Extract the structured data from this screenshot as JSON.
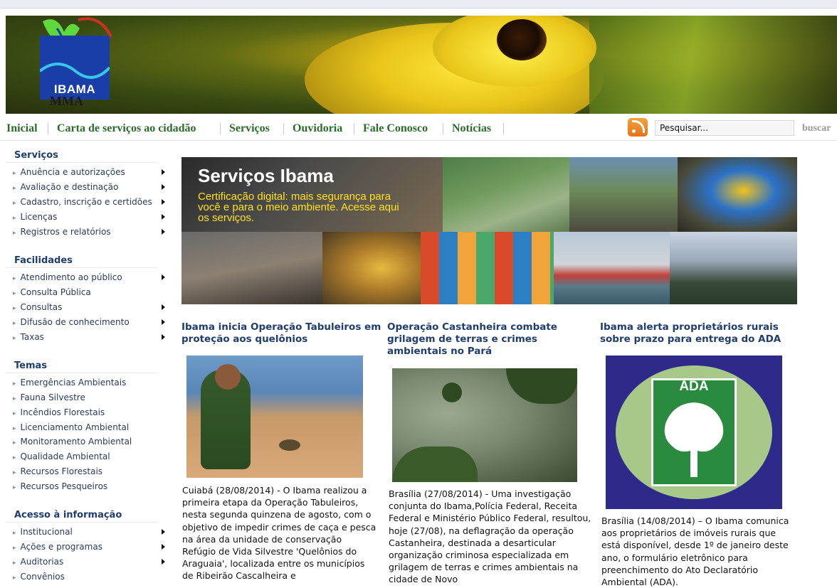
{
  "header": {
    "logo_text": "IBAMA",
    "logo_sub": "MMA"
  },
  "nav": {
    "items": [
      "Inicial",
      "Carta de serviços ao cidadão",
      "Serviços",
      "Ouvidoria",
      "Fale Conosco",
      "Notícias"
    ],
    "search_placeholder": "Pesquisar...",
    "search_button": "buscar"
  },
  "sidebar": {
    "sections": [
      {
        "title": "Serviços",
        "items": [
          {
            "label": "Anuência e autorizações",
            "submenu": true
          },
          {
            "label": "Avaliação e destinação",
            "submenu": true
          },
          {
            "label": "Cadastro, inscrição e certidões",
            "submenu": true
          },
          {
            "label": "Licenças",
            "submenu": true
          },
          {
            "label": "Registros e relatórios",
            "submenu": true
          }
        ]
      },
      {
        "title": "Facilidades",
        "items": [
          {
            "label": "Atendimento ao público",
            "submenu": true
          },
          {
            "label": "Consulta Pública",
            "submenu": false
          },
          {
            "label": "Consultas",
            "submenu": true
          },
          {
            "label": "Difusão de conhecimento",
            "submenu": true
          },
          {
            "label": "Taxas",
            "submenu": true
          }
        ]
      },
      {
        "title": "Temas",
        "items": [
          {
            "label": "Emergências Ambientais",
            "submenu": false
          },
          {
            "label": "Fauna Silvestre",
            "submenu": false
          },
          {
            "label": "Incêndios Florestais",
            "submenu": false
          },
          {
            "label": "Licenciamento Ambiental",
            "submenu": false
          },
          {
            "label": "Monitoramento Ambiental",
            "submenu": false
          },
          {
            "label": "Qualidade Ambiental",
            "submenu": false
          },
          {
            "label": "Recursos Florestais",
            "submenu": false
          },
          {
            "label": "Recursos Pesqueiros",
            "submenu": false
          }
        ]
      },
      {
        "title": "Acesso à informação",
        "items": [
          {
            "label": "Institucional",
            "submenu": true
          },
          {
            "label": "Ações e programas",
            "submenu": true
          },
          {
            "label": "Auditorias",
            "submenu": true
          },
          {
            "label": "Convênios",
            "submenu": false
          }
        ]
      }
    ]
  },
  "hero": {
    "title": "Serviços Ibama",
    "subtitle": "Certificação digital: mais segurança para você e para o meio ambiente. Acesse aqui os serviços."
  },
  "news": [
    {
      "title": "Ibama inicia Operação Tabuleiros em proteção aos quelônios",
      "text": "Cuiabá (28/08/2014) - O Ibama realizou a primeira etapa da Operação Tabuleiros, nesta segunda quinzena de agosto, com o objetivo de impedir crimes de caça e pesca na área da unidade de conservação Refúgio de Vida Silvestre 'Quelônios do Araguaia', localizada entre os municípios de Ribeirão Cascalheira e"
    },
    {
      "title": "Operação Castanheira combate grilagem de terras e crimes ambientais no Pará",
      "text": "Brasília (27/08/2014) - Uma investigação conjunta do Ibama,Polícia Federal, Receita Federal e Ministério Público Federal, resultou, hoje (27/08), na deflagração da operação Castanheira, destinada a desarticular organização criminosa especializada em grilagem de terras e crimes ambientais na cidade de Novo"
    },
    {
      "title": "Ibama alerta proprietários rurais sobre prazo para entrega do ADA",
      "text": "Brasília (14/08/2014) – O Ibama comunica aos proprietários de imóveis rurais que está disponível, desde 1º de janeiro deste ano, o formulário eletrônico para preenchimento do Ato Declaratório Ambiental (ADA).",
      "image_label": "ADA"
    }
  ]
}
